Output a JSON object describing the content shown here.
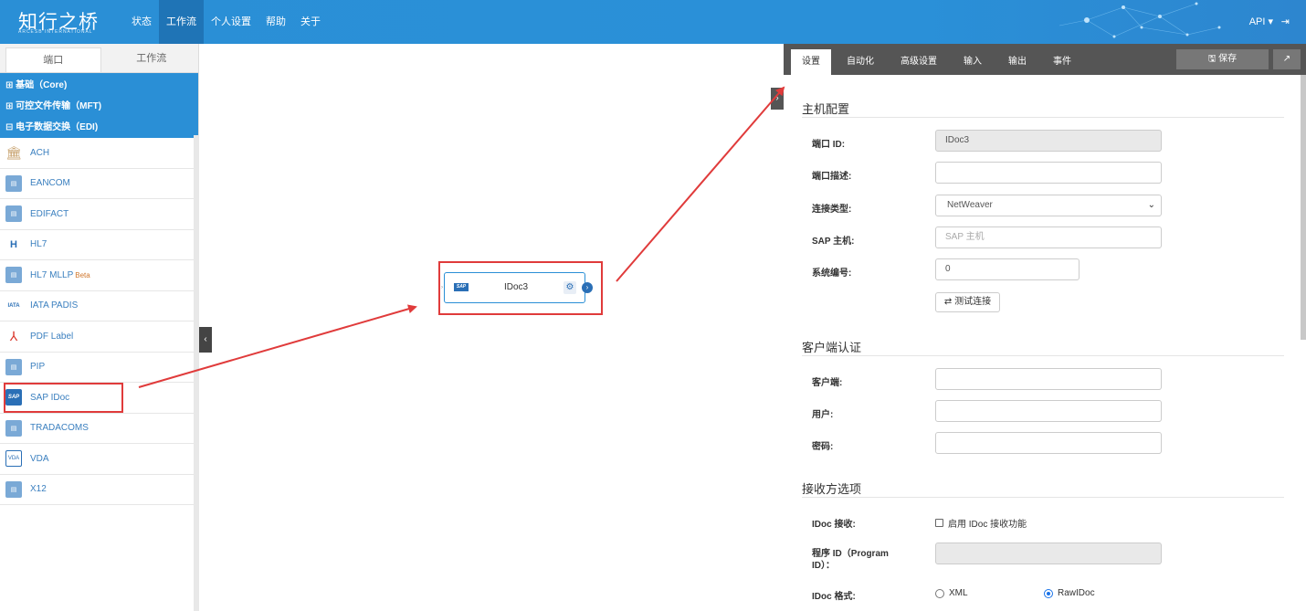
{
  "header": {
    "logo_text": "知行之桥",
    "logo_sub": "ARCESB INTERNATIONAL",
    "nav": [
      "状态",
      "工作流",
      "个人设置",
      "帮助",
      "关于"
    ],
    "api_label": "API ▾",
    "logout_icon": "logout-icon"
  },
  "left_panel": {
    "tabs": [
      "端口",
      "工作流"
    ],
    "categories": [
      "⊞ 基础（Core)",
      "⊞ 可控文件传输（MFT)",
      "⊟ 电子数据交换（EDI)"
    ],
    "items": [
      {
        "label": "ACH",
        "icon": "bank-icon"
      },
      {
        "label": "EANCOM",
        "icon": "document-icon"
      },
      {
        "label": "EDIFACT",
        "icon": "document-icon"
      },
      {
        "label": "HL7",
        "icon": "hl7-icon"
      },
      {
        "label": "HL7 MLLP",
        "badge": "Beta",
        "icon": "document-icon"
      },
      {
        "label": "IATA PADIS",
        "icon": "iata-icon"
      },
      {
        "label": "PDF Label",
        "icon": "pdf-icon"
      },
      {
        "label": "PIP",
        "icon": "document-icon"
      },
      {
        "label": "SAP IDoc",
        "icon": "sap-icon"
      },
      {
        "label": "TRADACOMS",
        "icon": "document-icon"
      },
      {
        "label": "VDA",
        "icon": "vda-icon"
      },
      {
        "label": "X12",
        "icon": "document-icon"
      }
    ]
  },
  "canvas": {
    "node_label": "IDoc3",
    "node_logo": "SAP"
  },
  "right_panel": {
    "tabs": [
      "设置",
      "自动化",
      "高级设置",
      "输入",
      "输出",
      "事件"
    ],
    "save_label": "🖫 保存",
    "host_section": "主机配置",
    "port_id_label": "端口 ID:",
    "port_id_value": "IDoc3",
    "port_desc_label": "端口描述:",
    "conn_type_label": "连接类型:",
    "conn_type_value": "NetWeaver",
    "sap_host_label": "SAP 主机:",
    "sap_host_placeholder": "SAP 主机",
    "sys_no_label": "系统编号:",
    "sys_no_value": "0",
    "test_button": "⇄ 测试连接",
    "client_section": "客户端认证",
    "client_label": "客户端:",
    "user_label": "用户:",
    "password_label": "密码:",
    "receiver_section": "接收方选项",
    "idoc_recv_label": "IDoc 接收:",
    "idoc_recv_checkbox": "启用 IDoc 接收功能",
    "program_id_label": "程序 ID（Program ID）：",
    "idoc_format_label": "IDoc 格式:",
    "format_options": [
      "XML",
      "RawIDoc"
    ],
    "format_selected": "RawIDoc"
  },
  "colors": {
    "header_bg": "#2a8fd6",
    "highlight": "#e03b3b",
    "link": "#3a7fbf"
  }
}
